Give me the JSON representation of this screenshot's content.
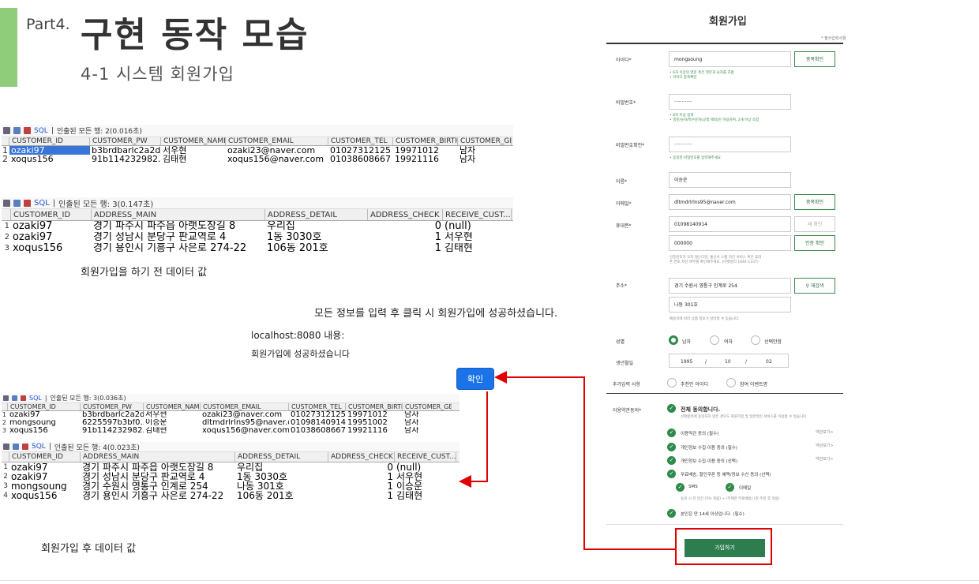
{
  "slide": {
    "part": "Part4.",
    "title": "구현 동작 모습",
    "subtitle": "4-1 시스템 회원가입"
  },
  "toolbar": {
    "sql": "SQL",
    "sep": "|"
  },
  "table1": {
    "status": "인출된 모든 행: 2(0.016초)",
    "headers": [
      "CUSTOMER_ID",
      "CUSTOMER_PW",
      "CUSTOMER_NAME",
      "CUSTOMER_EMAIL",
      "CUSTOMER_TEL",
      "CUSTOMER_BIRTH",
      "CUSTOMER_GE..."
    ],
    "rows": [
      {
        "n": "1",
        "c": [
          "ozaki97",
          "b3brdbarlc2a2d...",
          "서우현",
          "ozaki23@naver.com",
          "01027312125",
          "19971012",
          "남자"
        ]
      },
      {
        "n": "2",
        "c": [
          "xoqus156",
          "91b114232982...",
          "김태현",
          "xoqus156@naver.com",
          "01038608667",
          "19921116",
          "남자"
        ]
      }
    ]
  },
  "table2": {
    "status": "인출된 모든 행: 3(0.147초)",
    "headers": [
      "CUSTOMER_ID",
      "ADDRESS_MAIN",
      "ADDRESS_DETAIL",
      "ADDRESS_CHECK",
      "RECEIVE_CUST..."
    ],
    "rows": [
      {
        "n": "1",
        "c": [
          "ozaki97",
          "경기 파주시 파주읍 아랫도장길 8",
          "우리집",
          "0",
          "(null)"
        ]
      },
      {
        "n": "2",
        "c": [
          "ozaki97",
          "경기 성남시 분당구 판교역로 4",
          "1동 3030호",
          "1",
          "서우현"
        ]
      },
      {
        "n": "3",
        "c": [
          "xoqus156",
          "경기 용인시 기흥구 사은로 274-22",
          "106동 201호",
          "1",
          "김태현"
        ]
      }
    ]
  },
  "captions": {
    "before": "회원가입을 하기 전 데이터 값",
    "after": "회원가입 후 데이터 값",
    "instruction": "모든 정보를 입력 후 클릭 시 회원가입에 성공하셨습니다."
  },
  "alert": {
    "host": "localhost:8080 내용:",
    "message": "회원가입에 성공하셨습니다",
    "ok": "확인"
  },
  "table3": {
    "status": "인출된 모든 행: 3(0.036초)",
    "headers": [
      "CUSTOMER_ID",
      "CUSTOMER_PW",
      "CUSTOMER_NAME",
      "CUSTOMER_EMAIL",
      "CUSTOMER_TEL",
      "CUSTOMER_BIRTH",
      "CUSTOMER_GE..."
    ],
    "rows": [
      {
        "n": "1",
        "c": [
          "ozaki97",
          "b3brdbarlc2a2d...",
          "서우현",
          "ozaki23@naver.com",
          "01027312125",
          "19971012",
          "남자"
        ]
      },
      {
        "n": "2",
        "c": [
          "mongsoung",
          "6225597b3bf0...",
          "이승운",
          "dltmdrlrlns95@naver.c...",
          "01098140914",
          "19951002",
          "남자"
        ]
      },
      {
        "n": "3",
        "c": [
          "xoqus156",
          "91b114232982...",
          "김태현",
          "xoqus156@naver.com",
          "01038608667",
          "19921116",
          "남자"
        ]
      }
    ]
  },
  "table4": {
    "status": "인출된 모든 행: 4(0.023초)",
    "headers": [
      "CUSTOMER_ID",
      "ADDRESS_MAIN",
      "ADDRESS_DETAIL",
      "ADDRESS_CHECK",
      "RECEIVE_CUST..."
    ],
    "rows": [
      {
        "n": "1",
        "c": [
          "ozaki97",
          "경기 파주시 파주읍 아랫도장길 8",
          "우리집",
          "0",
          "(null)"
        ]
      },
      {
        "n": "2",
        "c": [
          "ozaki97",
          "경기 성남시 분당구 판교역로 4",
          "1동 3030호",
          "1",
          "서우현"
        ]
      },
      {
        "n": "3",
        "c": [
          "mongsoung",
          "경기 수원시 영통구 인계로 254",
          "나동 301호",
          "1",
          "이승운"
        ]
      },
      {
        "n": "4",
        "c": [
          "xoqus156",
          "경기 용인시 기흥구 사은로 274-22",
          "106동 201호",
          "1",
          "김태현"
        ]
      }
    ]
  },
  "form": {
    "title": "회원가입",
    "required": "* 필수입력사항",
    "id_label": "아이디*",
    "id_value": "mongsoung",
    "id_check": "중복확인",
    "id_hint1": "• 6자 이상의 영문 혹은 영문과 숫자를 조합",
    "id_hint2": "• 아이디 중복확인",
    "pw_label": "비밀번호*",
    "pw_value": "············",
    "pw_hint1": "• 8자 이상 입력",
    "pw_hint2": "• 영문/숫자/특수문자(공백 제외)만 허용하며, 2개 이상 조합",
    "pw2_label": "비밀번호확인*",
    "pw2_value": "············",
    "pw2_hint": "• 동일한 비밀번호를 입력해주세요.",
    "name_label": "이름*",
    "name_value": "이승운",
    "email_label": "이메일*",
    "email_value": "dltmdrlrlns95@naver.com",
    "email_check": "중복확인",
    "phone_label": "휴대폰*",
    "phone_value": "01098140914",
    "phone_send": "재 확인",
    "code_value": "000000",
    "code_check": "인증 확인",
    "phone_hint": "인증번호가 오지 않는다면, 통신사 스팸 차단 서비스 혹은 휴대폰 번호 차단 여부를 확인해주세요. (마켓컬리 1644-1107)",
    "addr_label": "주소*",
    "addr_value": "경기 수원시 영통구 인계로 254",
    "addr_search": "재검색",
    "addr_detail": "나동 301호",
    "addr_hint": "배송지에 따라 상품 정보가 달라질 수 있습니다.",
    "gender_label": "성별",
    "gender_opts": [
      "남자",
      "여자",
      "선택안함"
    ],
    "birth_label": "생년월일",
    "birth_y": "1995",
    "birth_m": "10",
    "birth_d": "02",
    "birth_sep": "/",
    "extra_label": "추가입력 사항",
    "extra_opts": [
      "추천인 아이디",
      "참여 이벤트명"
    ],
    "terms_label": "이용약관동의*",
    "terms_all": "전체 동의합니다.",
    "terms_all_hint": "선택항목에 동의하지 않은 경우도 회원가입 및 일반적인 서비스를 이용할 수 있습니다.",
    "terms": [
      "이용약관 동의 (필수)",
      "개인정보 수집·이용 동의 (필수)",
      "개인정보 수집·이용 동의 (선택)",
      "무료배송, 할인쿠폰 등 혜택/정보 수신 동의 (선택)"
    ],
    "terms_more": "약관보기>",
    "sms": "SMS",
    "email_opt": "이메일",
    "benefit_hint": "동의 시 한 달간 [5% 적립] + [무제한 무료배송] (첫 주문 후 적용)",
    "age": "본인은 만 14세 이상입니다. (필수)",
    "join": "가입하기"
  },
  "colors": {
    "accent": "#2e7d4f",
    "highlight": "#e00000",
    "greenbar": "#8fcd7b"
  }
}
